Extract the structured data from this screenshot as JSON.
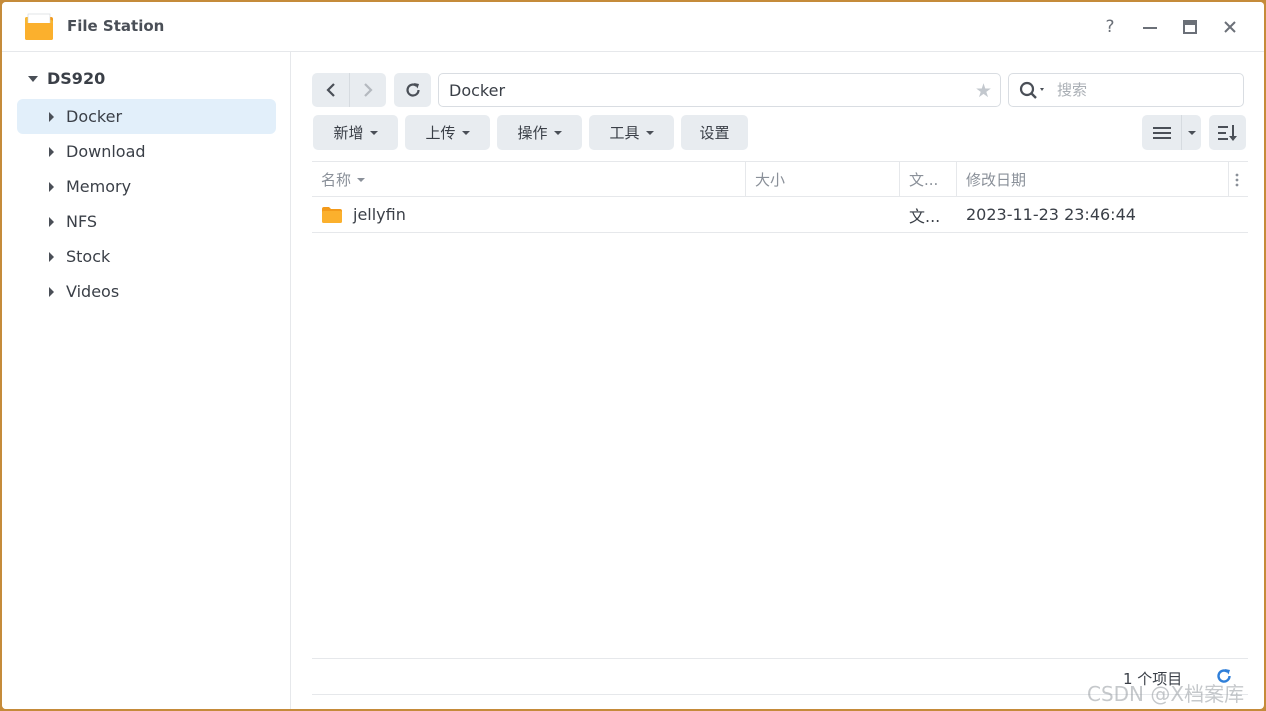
{
  "window": {
    "title": "File Station",
    "controls": {
      "help": "?"
    }
  },
  "sidebar": {
    "root": "DS920",
    "items": [
      {
        "label": "Docker",
        "selected": true
      },
      {
        "label": "Download"
      },
      {
        "label": "Memory"
      },
      {
        "label": "NFS"
      },
      {
        "label": "Stock"
      },
      {
        "label": "Videos"
      }
    ]
  },
  "nav": {
    "path": "Docker",
    "search_placeholder": "搜索"
  },
  "toolbar": {
    "new_label": "新增",
    "upload_label": "上传",
    "action_label": "操作",
    "tools_label": "工具",
    "settings_label": "设置"
  },
  "table": {
    "columns": [
      "名称",
      "大小",
      "文...",
      "修改日期"
    ],
    "rows": [
      {
        "name": "jellyfin",
        "size": "",
        "type": "文...",
        "modified": "2023-11-23 23:46:44"
      }
    ]
  },
  "footer": {
    "count": "1 个项目"
  },
  "watermark": "CSDN @X档案库",
  "colors": {
    "accent": "#e2effa",
    "folder": "#f7a81c",
    "refresh": "#2f7fd9"
  }
}
